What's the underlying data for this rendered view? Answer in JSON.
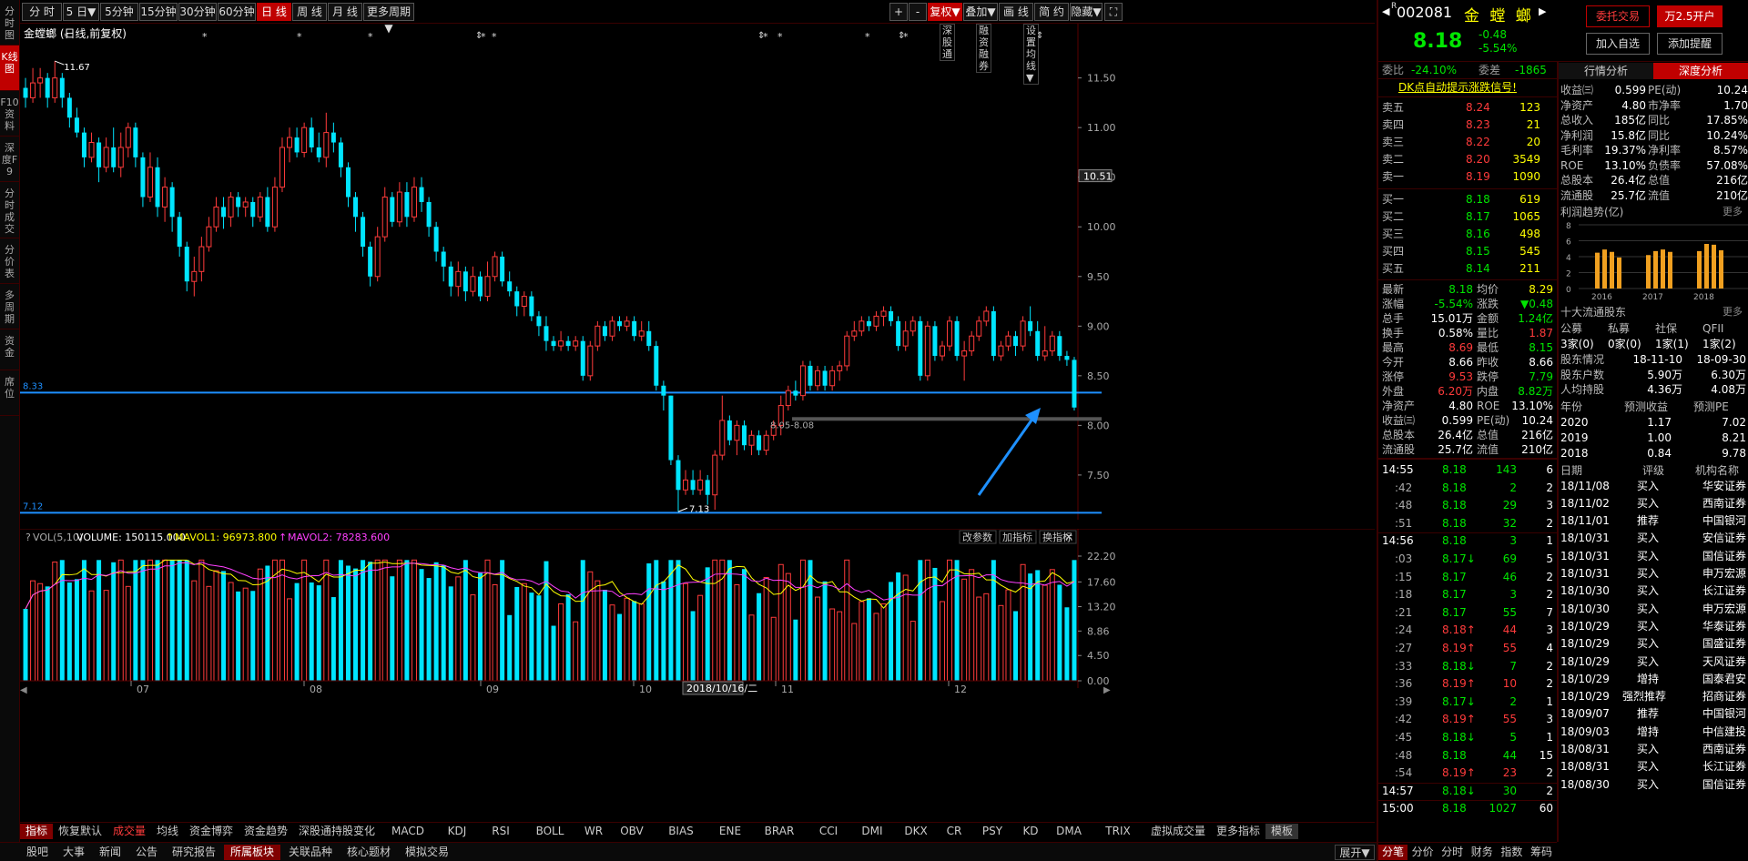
{
  "sidebar": [
    "分时图",
    "K线图",
    "F10资料",
    "深度F9",
    "分时成交",
    "分价表",
    "多周期",
    "资金",
    "席位"
  ],
  "toolbar": {
    "periods": [
      "分 时",
      "5 日▼",
      "5分钟",
      "15分钟",
      "30分钟",
      "60分钟",
      "日 线",
      "周 线",
      "月 线",
      "更多周期▼"
    ],
    "right": [
      "+",
      "-",
      "复权▼",
      "叠加▼",
      "画 线",
      "简 约",
      "隐藏▼"
    ]
  },
  "chart": {
    "title": "金螳螂 (日线,前复权)",
    "buttons": [
      "深股通",
      "融资融券",
      "设置均线▼"
    ],
    "ohlc": [
      [
        11.4,
        11.3,
        11.5,
        11.2
      ],
      [
        11.3,
        11.45,
        11.6,
        11.25
      ],
      [
        11.45,
        11.5,
        11.6,
        11.3
      ],
      [
        11.5,
        11.3,
        11.55,
        11.2
      ],
      [
        11.3,
        11.5,
        11.67,
        11.25
      ],
      [
        11.5,
        11.3,
        11.55,
        11.2
      ],
      [
        11.3,
        11.1,
        11.35,
        11.0
      ],
      [
        11.1,
        10.95,
        11.2,
        10.9
      ],
      [
        10.95,
        10.7,
        11.0,
        10.6
      ],
      [
        10.7,
        10.85,
        10.95,
        10.65
      ],
      [
        10.85,
        10.6,
        10.9,
        10.45
      ],
      [
        10.6,
        10.8,
        10.9,
        10.55
      ],
      [
        10.8,
        10.6,
        11.0,
        10.55
      ],
      [
        10.6,
        10.8,
        10.95,
        10.5
      ],
      [
        10.8,
        11.0,
        11.05,
        10.7
      ],
      [
        11.0,
        10.7,
        11.05,
        10.6
      ],
      [
        10.7,
        10.3,
        10.75,
        10.2
      ],
      [
        10.3,
        10.6,
        10.75,
        10.25
      ],
      [
        10.6,
        10.2,
        10.7,
        10.1
      ],
      [
        10.2,
        10.4,
        10.5,
        10.05
      ],
      [
        10.4,
        10.1,
        10.45,
        9.95
      ],
      [
        10.1,
        9.8,
        10.15,
        9.7
      ],
      [
        9.8,
        9.45,
        9.85,
        9.35
      ],
      [
        9.45,
        9.55,
        9.7,
        9.3
      ],
      [
        9.55,
        9.8,
        9.9,
        9.45
      ],
      [
        9.8,
        10.0,
        10.1,
        9.75
      ],
      [
        10.0,
        10.2,
        10.3,
        9.95
      ],
      [
        10.2,
        10.1,
        10.3,
        9.98
      ],
      [
        10.1,
        10.3,
        10.35,
        10.0
      ],
      [
        10.3,
        10.2,
        10.35,
        10.1
      ],
      [
        10.2,
        10.25,
        10.3,
        10.1
      ],
      [
        10.25,
        10.1,
        10.3,
        10.0
      ],
      [
        10.1,
        10.3,
        10.35,
        10.05
      ],
      [
        10.3,
        10.0,
        10.4,
        9.95
      ],
      [
        10.0,
        10.4,
        10.5,
        9.95
      ],
      [
        10.4,
        10.8,
        10.9,
        10.35
      ],
      [
        10.8,
        10.9,
        11.0,
        10.65
      ],
      [
        10.9,
        10.75,
        11.0,
        10.7
      ],
      [
        10.75,
        11.0,
        11.05,
        10.7
      ],
      [
        11.0,
        10.8,
        11.1,
        10.75
      ],
      [
        10.8,
        10.7,
        10.95,
        10.65
      ],
      [
        10.7,
        10.95,
        11.15,
        10.6
      ],
      [
        10.95,
        10.85,
        11.05,
        10.75
      ],
      [
        10.85,
        10.6,
        10.9,
        10.5
      ],
      [
        10.6,
        10.3,
        10.65,
        10.2
      ],
      [
        10.3,
        10.1,
        10.35,
        9.95
      ],
      [
        10.1,
        9.8,
        10.15,
        9.7
      ],
      [
        9.8,
        9.5,
        9.85,
        9.4
      ],
      [
        9.5,
        9.9,
        10.0,
        9.45
      ],
      [
        9.9,
        10.3,
        10.4,
        9.85
      ],
      [
        10.3,
        10.05,
        10.35,
        10.0
      ],
      [
        10.05,
        10.35,
        10.45,
        10.0
      ],
      [
        10.35,
        10.1,
        10.45,
        10.0
      ],
      [
        10.1,
        10.4,
        10.5,
        10.05
      ],
      [
        10.4,
        10.25,
        10.5,
        10.15
      ],
      [
        10.25,
        10.0,
        10.3,
        9.9
      ],
      [
        10.0,
        9.75,
        10.05,
        9.65
      ],
      [
        9.75,
        9.6,
        9.8,
        9.45
      ],
      [
        9.6,
        9.4,
        9.65,
        9.3
      ],
      [
        9.4,
        9.55,
        9.65,
        9.3
      ],
      [
        9.55,
        9.35,
        9.6,
        9.25
      ],
      [
        9.35,
        9.5,
        9.6,
        9.3
      ],
      [
        9.5,
        9.3,
        9.55,
        9.25
      ],
      [
        9.3,
        9.5,
        9.65,
        9.25
      ],
      [
        9.5,
        9.7,
        9.75,
        9.45
      ],
      [
        9.7,
        9.45,
        9.75,
        9.4
      ],
      [
        9.45,
        9.35,
        9.55,
        9.3
      ],
      [
        9.35,
        9.2,
        9.4,
        9.1
      ],
      [
        9.2,
        9.3,
        9.35,
        9.1
      ],
      [
        9.3,
        9.1,
        9.35,
        9.05
      ],
      [
        9.1,
        9.0,
        9.15,
        8.9
      ],
      [
        9.0,
        8.85,
        9.1,
        8.75
      ],
      [
        8.85,
        8.8,
        8.9,
        8.75
      ],
      [
        8.8,
        8.85,
        8.95,
        8.75
      ],
      [
        8.85,
        8.8,
        8.9,
        8.75
      ],
      [
        8.8,
        8.85,
        8.9,
        8.75
      ],
      [
        8.85,
        8.5,
        8.9,
        8.45
      ],
      [
        8.5,
        8.8,
        8.85,
        8.45
      ],
      [
        8.8,
        9.0,
        9.05,
        8.75
      ],
      [
        9.0,
        8.9,
        9.05,
        8.85
      ],
      [
        8.9,
        9.05,
        9.1,
        8.85
      ],
      [
        9.05,
        9.0,
        9.1,
        8.95
      ],
      [
        9.0,
        9.05,
        9.1,
        8.95
      ],
      [
        9.05,
        8.9,
        9.1,
        8.85
      ],
      [
        8.9,
        8.95,
        9.05,
        8.85
      ],
      [
        8.95,
        8.8,
        9.05,
        8.75
      ],
      [
        8.8,
        8.4,
        8.85,
        8.35
      ],
      [
        8.4,
        8.3,
        8.45,
        8.15
      ],
      [
        8.3,
        7.65,
        8.3,
        7.6
      ],
      [
        7.65,
        7.35,
        7.7,
        7.13
      ],
      [
        7.35,
        7.45,
        7.55,
        7.3
      ],
      [
        7.45,
        7.35,
        7.55,
        7.3
      ],
      [
        7.35,
        7.45,
        7.55,
        7.3
      ],
      [
        7.45,
        7.3,
        7.5,
        7.2
      ],
      [
        7.3,
        7.7,
        7.75,
        7.15
      ],
      [
        7.7,
        8.05,
        8.3,
        7.65
      ],
      [
        8.05,
        7.85,
        8.1,
        7.8
      ],
      [
        7.85,
        8.0,
        8.05,
        7.7
      ],
      [
        8.0,
        7.8,
        8.05,
        7.75
      ],
      [
        7.8,
        7.9,
        7.95,
        7.7
      ],
      [
        7.9,
        7.75,
        7.95,
        7.7
      ],
      [
        7.75,
        7.9,
        7.95,
        7.7
      ],
      [
        7.9,
        8.0,
        8.05,
        7.85
      ],
      [
        8.0,
        8.2,
        8.3,
        7.9
      ],
      [
        8.2,
        8.35,
        8.4,
        8.15
      ],
      [
        8.35,
        8.3,
        8.45,
        8.25
      ],
      [
        8.3,
        8.6,
        8.65,
        8.25
      ],
      [
        8.6,
        8.4,
        8.65,
        8.35
      ],
      [
        8.4,
        8.55,
        8.6,
        8.35
      ],
      [
        8.55,
        8.4,
        8.6,
        8.35
      ],
      [
        8.4,
        8.55,
        8.6,
        8.35
      ],
      [
        8.55,
        8.6,
        8.65,
        8.45
      ],
      [
        8.6,
        8.9,
        8.95,
        8.55
      ],
      [
        8.9,
        8.95,
        9.05,
        8.85
      ],
      [
        8.95,
        9.05,
        9.1,
        8.9
      ],
      [
        9.05,
        9.0,
        9.1,
        8.95
      ],
      [
        9.0,
        9.1,
        9.15,
        8.95
      ],
      [
        9.1,
        9.15,
        9.2,
        9.0
      ],
      [
        9.15,
        9.05,
        9.2,
        9.0
      ],
      [
        9.05,
        8.8,
        9.1,
        8.75
      ],
      [
        8.8,
        8.95,
        9.05,
        8.75
      ],
      [
        8.95,
        9.05,
        9.1,
        8.9
      ],
      [
        9.05,
        8.5,
        9.1,
        8.45
      ],
      [
        8.5,
        9.0,
        9.05,
        8.45
      ],
      [
        9.0,
        8.7,
        9.05,
        8.65
      ],
      [
        8.7,
        8.8,
        8.85,
        8.65
      ],
      [
        8.8,
        9.05,
        9.1,
        8.75
      ],
      [
        9.05,
        8.7,
        9.1,
        8.65
      ],
      [
        8.7,
        8.75,
        8.85,
        8.45
      ],
      [
        8.75,
        8.9,
        8.95,
        8.7
      ],
      [
        8.9,
        9.05,
        9.1,
        8.85
      ],
      [
        9.05,
        9.15,
        9.2,
        9.0
      ],
      [
        9.15,
        8.7,
        9.2,
        8.65
      ],
      [
        8.7,
        8.8,
        8.85,
        8.65
      ],
      [
        8.8,
        8.9,
        8.95,
        8.75
      ],
      [
        8.9,
        8.8,
        8.95,
        8.7
      ],
      [
        8.8,
        9.05,
        9.1,
        8.75
      ],
      [
        9.05,
        8.95,
        9.2,
        8.9
      ],
      [
        8.95,
        8.7,
        9.05,
        8.65
      ],
      [
        8.7,
        8.75,
        9.0,
        8.65
      ],
      [
        8.75,
        8.9,
        8.95,
        8.7
      ],
      [
        8.9,
        8.7,
        8.95,
        8.65
      ],
      [
        8.7,
        8.66,
        8.75,
        8.6
      ],
      [
        8.66,
        8.18,
        8.69,
        8.15
      ]
    ],
    "prices": [
      "11.50",
      "11.00",
      "10.50",
      "10.00",
      "9.50",
      "9.00",
      "8.50",
      "8.00",
      "7.50"
    ],
    "current_tag": "10.51",
    "high_label": "11.67",
    "low_label": "7.13",
    "line_top": "8.33",
    "line_bottom": "7.12",
    "gap_label": "8.05-8.08",
    "vol_header": {
      "name": "VOL(5,10)",
      "volume": "VOLUME: 150115.000",
      "m1": "MAVOL1: 96973.800",
      "m2": "MAVOL2: 78283.600",
      "buttons": [
        "改参数",
        "加指标",
        "换指标"
      ]
    },
    "vol_axis": [
      "22.20",
      "17.60",
      "13.20",
      "8.86",
      "4.50",
      "0.00"
    ],
    "months": [
      "07",
      "08",
      "09",
      "10",
      "11",
      "12"
    ],
    "cursor_date": "2018/10/16/二"
  },
  "indicator_tabs": [
    "指标",
    "恢复默认",
    "成交量",
    "均线",
    "资金博弈",
    "资金趋势",
    "深股通持股变化",
    "MACD",
    "KDJ",
    "RSI",
    "BOLL",
    "WR",
    "OBV",
    "BIAS",
    "ENE",
    "BRAR",
    "CCI",
    "DMI",
    "DKX",
    "CR",
    "PSY",
    "KD",
    "DMA",
    "TRIX",
    "虚拟成交量",
    "更多指标",
    "模板"
  ],
  "status_tabs": [
    "股吧",
    "大事",
    "新闻",
    "公告",
    "研究报告",
    "所属板块",
    "关联品种",
    "核心题材",
    "模拟交易"
  ],
  "status_right": "展开▼",
  "stock": {
    "code": "002081",
    "name": "金 螳 螂",
    "price": "8.18",
    "change": "-0.48",
    "pct": "-5.54%",
    "weibi_label": "委比",
    "weibi": "-24.10%",
    "weicha_label": "委差",
    "weicha": "-1865",
    "dk": "DK点自动提示涨跌信号!"
  },
  "buttons": {
    "trade": "委托交易",
    "open": "万2.5开户",
    "fav": "加入自选",
    "alert": "添加提醒"
  },
  "asks": [
    [
      "卖五",
      "8.24",
      "123"
    ],
    [
      "卖四",
      "8.23",
      "21"
    ],
    [
      "卖三",
      "8.22",
      "20"
    ],
    [
      "卖二",
      "8.20",
      "3549"
    ],
    [
      "卖一",
      "8.19",
      "1090"
    ]
  ],
  "bids": [
    [
      "买一",
      "8.18",
      "619"
    ],
    [
      "买二",
      "8.17",
      "1065"
    ],
    [
      "买三",
      "8.16",
      "498"
    ],
    [
      "买四",
      "8.15",
      "545"
    ],
    [
      "买五",
      "8.14",
      "211"
    ]
  ],
  "quote": [
    [
      "最新",
      "8.18",
      "均价",
      "8.29"
    ],
    [
      "涨幅",
      "-5.54%",
      "涨跌",
      "▼0.48"
    ],
    [
      "总手",
      "15.01万",
      "金额",
      "1.24亿"
    ],
    [
      "换手",
      "0.58%",
      "量比",
      "1.87"
    ],
    [
      "最高",
      "8.69",
      "最低",
      "8.15"
    ],
    [
      "今开",
      "8.66",
      "昨收",
      "8.66"
    ],
    [
      "涨停",
      "9.53",
      "跌停",
      "7.79"
    ],
    [
      "外盘",
      "6.20万",
      "内盘",
      "8.82万"
    ],
    [
      "净资产",
      "4.80",
      "ROE",
      "13.10%"
    ],
    [
      "收益㈢",
      "0.599",
      "PE(动)",
      "10.24"
    ],
    [
      "总股本",
      "26.4亿",
      "总值",
      "216亿"
    ],
    [
      "流通股",
      "25.7亿",
      "流值",
      "210亿"
    ]
  ],
  "ticks": [
    [
      "14:55",
      "8.18",
      "143",
      "6"
    ],
    [
      ":42",
      "8.18",
      "2",
      "2"
    ],
    [
      ":48",
      "8.18",
      "29",
      "3"
    ],
    [
      ":51",
      "8.18",
      "32",
      "2"
    ],
    [
      "14:56",
      "8.18",
      "3",
      "1"
    ],
    [
      ":03",
      "8.17↓",
      "69",
      "5"
    ],
    [
      ":15",
      "8.17",
      "46",
      "2"
    ],
    [
      ":18",
      "8.17",
      "3",
      "2"
    ],
    [
      ":21",
      "8.17",
      "55",
      "7"
    ],
    [
      ":24",
      "8.18↑",
      "44",
      "3"
    ],
    [
      ":27",
      "8.19↑",
      "55",
      "4"
    ],
    [
      ":33",
      "8.18↓",
      "7",
      "2"
    ],
    [
      ":36",
      "8.19↑",
      "10",
      "2"
    ],
    [
      ":39",
      "8.17↓",
      "2",
      "1"
    ],
    [
      ":42",
      "8.19↑",
      "55",
      "3"
    ],
    [
      ":45",
      "8.18↓",
      "5",
      "1"
    ],
    [
      ":48",
      "8.18",
      "44",
      "15"
    ],
    [
      ":54",
      "8.19↑",
      "23",
      "2"
    ],
    [
      "14:57",
      "8.18↓",
      "30",
      "2"
    ],
    [
      "15:00",
      "8.18",
      "1027",
      "60"
    ]
  ],
  "analysis": {
    "tabs": [
      "行情分析",
      "深度分析"
    ],
    "fin": [
      [
        "收益㈢",
        "0.599",
        "PE(动)",
        "10.24"
      ],
      [
        "净资产",
        "4.80",
        "市净率",
        "1.70"
      ],
      [
        "总收入",
        "185亿",
        "同比",
        "17.85%"
      ],
      [
        "净利润",
        "15.8亿",
        "同比",
        "10.24%"
      ],
      [
        "毛利率",
        "19.37%",
        "净利率",
        "8.57%"
      ],
      [
        "ROE",
        "13.10%",
        "负债率",
        "57.08%"
      ],
      [
        "总股本",
        "26.4亿",
        "总值",
        "216亿"
      ],
      [
        "流通股",
        "25.7亿",
        "流值",
        "210亿"
      ]
    ],
    "profit_title": "利润趋势(亿)",
    "more": "更多",
    "profit_axis": [
      "8",
      "6",
      "4",
      "2",
      "0"
    ],
    "profit_years": [
      "2016",
      "2017",
      "2018"
    ],
    "profit_bars": [
      [
        4.5,
        4.9,
        4.6,
        3.9
      ],
      [
        4.2,
        4.7,
        4.9,
        4.6
      ],
      [
        4.7,
        5.6,
        5.5,
        4.8
      ]
    ],
    "holders_title": "十大流通股东",
    "holders_head": [
      "公募",
      "私募",
      "社保",
      "QFII"
    ],
    "holders_vals": [
      "3家(0)",
      "0家(0)",
      "1家(1)",
      "1家(2)"
    ],
    "hold_rows": [
      [
        "股东情况",
        "18-11-10",
        "18-09-30"
      ],
      [
        "股东户数",
        "5.90万",
        "6.30万"
      ],
      [
        "人均持股",
        "4.36万",
        "4.08万"
      ]
    ],
    "eps_head": [
      "年份",
      "预测收益",
      "预测PE"
    ],
    "eps": [
      [
        "2020",
        "1.17",
        "7.02"
      ],
      [
        "2019",
        "1.00",
        "8.21"
      ],
      [
        "2018",
        "0.84",
        "9.78"
      ]
    ],
    "rating_head": [
      "日期",
      "评级",
      "机构名称"
    ],
    "ratings": [
      [
        "18/11/08",
        "买入",
        "华安证券"
      ],
      [
        "18/11/02",
        "买入",
        "西南证券"
      ],
      [
        "18/11/01",
        "推荐",
        "中国银河"
      ],
      [
        "18/10/31",
        "买入",
        "安信证券"
      ],
      [
        "18/10/31",
        "买入",
        "国信证券"
      ],
      [
        "18/10/31",
        "买入",
        "申万宏源"
      ],
      [
        "18/10/30",
        "买入",
        "长江证券"
      ],
      [
        "18/10/30",
        "买入",
        "申万宏源"
      ],
      [
        "18/10/29",
        "买入",
        "华泰证券"
      ],
      [
        "18/10/29",
        "买入",
        "国盛证券"
      ],
      [
        "18/10/29",
        "买入",
        "天风证券"
      ],
      [
        "18/10/29",
        "增持",
        "国泰君安"
      ],
      [
        "18/10/29",
        "强烈推荐",
        "招商证券"
      ],
      [
        "18/09/07",
        "推荐",
        "中国银河"
      ],
      [
        "18/09/03",
        "增持",
        "中信建投"
      ],
      [
        "18/08/31",
        "买入",
        "西南证券"
      ],
      [
        "18/08/31",
        "买入",
        "长江证券"
      ],
      [
        "18/08/30",
        "买入",
        "国信证券"
      ]
    ]
  },
  "right_tabs": [
    "分笔",
    "分价",
    "分时",
    "财务",
    "指数",
    "筹码"
  ]
}
